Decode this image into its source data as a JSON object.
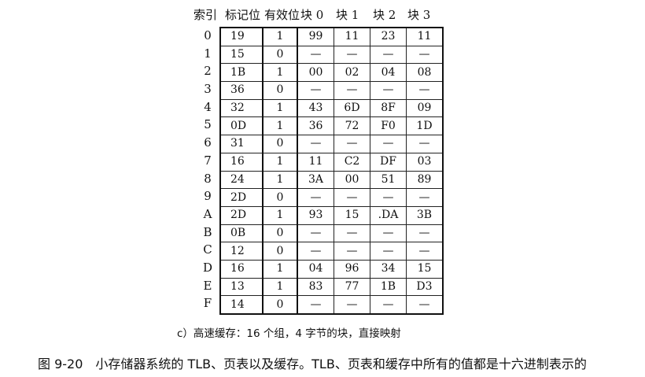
{
  "headers": {
    "index": "索引",
    "tag": "标记位",
    "valid": "有效位",
    "block0": "块 0",
    "block1": "块 1",
    "block2": "块 2",
    "block3": "块 3"
  },
  "rows": [
    {
      "index": "0",
      "tag": "19",
      "valid": "1",
      "b0": "99",
      "b1": "11",
      "b2": "23",
      "b3": "11"
    },
    {
      "index": "1",
      "tag": "15",
      "valid": "0",
      "b0": "—",
      "b1": "—",
      "b2": "—",
      "b3": "—"
    },
    {
      "index": "2",
      "tag": "1B",
      "valid": "1",
      "b0": "00",
      "b1": "02",
      "b2": "04",
      "b3": "08"
    },
    {
      "index": "3",
      "tag": "36",
      "valid": "0",
      "b0": "—",
      "b1": "—",
      "b2": "—",
      "b3": "—"
    },
    {
      "index": "4",
      "tag": "32",
      "valid": "1",
      "b0": "43",
      "b1": "6D",
      "b2": "8F",
      "b3": "09"
    },
    {
      "index": "5",
      "tag": "0D",
      "valid": "1",
      "b0": "36",
      "b1": "72",
      "b2": "F0",
      "b3": "1D"
    },
    {
      "index": "6",
      "tag": "31",
      "valid": "0",
      "b0": "—",
      "b1": "—",
      "b2": "—",
      "b3": "—"
    },
    {
      "index": "7",
      "tag": "16",
      "valid": "1",
      "b0": "11",
      "b1": "C2",
      "b2": "DF",
      "b3": "03"
    },
    {
      "index": "8",
      "tag": "24",
      "valid": "1",
      "b0": "3A",
      "b1": "00",
      "b2": "51",
      "b3": "89"
    },
    {
      "index": "9",
      "tag": "2D",
      "valid": "0",
      "b0": "—",
      "b1": "—",
      "b2": "—",
      "b3": "—"
    },
    {
      "index": "A",
      "tag": "2D",
      "valid": "1",
      "b0": "93",
      "b1": "15",
      "b2": ".DA",
      "b3": "3B"
    },
    {
      "index": "B",
      "tag": "0B",
      "valid": "0",
      "b0": "—",
      "b1": "—",
      "b2": "—",
      "b3": "—"
    },
    {
      "index": "C",
      "tag": "12",
      "valid": "0",
      "b0": "—",
      "b1": "—",
      "b2": "—",
      "b3": "—"
    },
    {
      "index": "D",
      "tag": "16",
      "valid": "1",
      "b0": "04",
      "b1": "96",
      "b2": "34",
      "b3": "15"
    },
    {
      "index": "E",
      "tag": "13",
      "valid": "1",
      "b0": "83",
      "b1": "77",
      "b2": "1B",
      "b3": "D3"
    },
    {
      "index": "F",
      "tag": "14",
      "valid": "0",
      "b0": "—",
      "b1": "—",
      "b2": "—",
      "b3": "—"
    }
  ],
  "subcaption": "c）高速缓存：16 个组，4 字节的块，直接映射",
  "figure_caption": "图 9-20　小存储器系统的 TLB、页表以及缓存。TLB、页表和缓存中所有的值都是十六进制表示的"
}
